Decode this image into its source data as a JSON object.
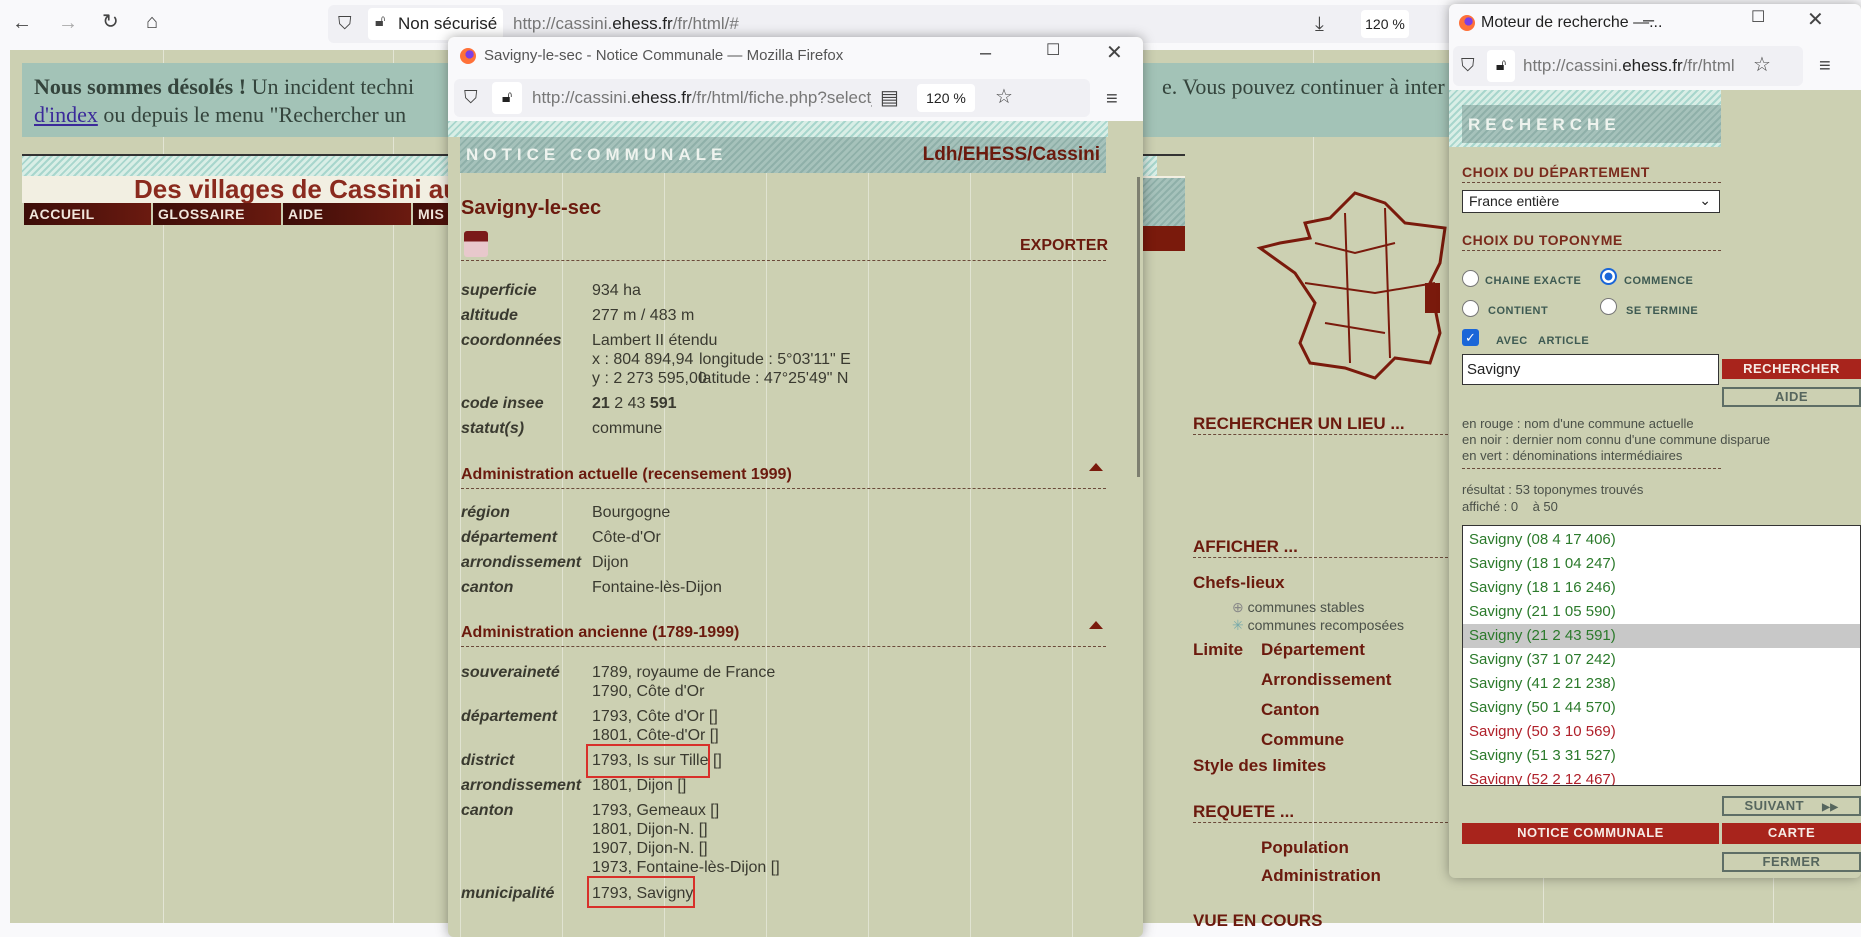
{
  "browser": {
    "security_label": "Non sécurisé",
    "url_prefix": "http://cassini.",
    "url_domain": "ehess.fr",
    "url_suffix": "/fr/html/#",
    "zoom": "120 %"
  },
  "banner": {
    "bold": "Nous sommes désolés !",
    "text1": " Un incident techni",
    "text1b": "e. Vous pouvez continuer à inter",
    "link": "d'index",
    "text2": " ou depuis le menu \"Rechercher un "
  },
  "site": {
    "title": "Des villages de Cassini aux",
    "nav": [
      "ACCUEIL",
      "GLOSSAIRE",
      "AIDE",
      "MIS"
    ]
  },
  "menu": {
    "search_place": "RECHERCHER UN LIEU ...",
    "display": "AFFICHER ...",
    "chefs_lieux": "Chefs-lieux",
    "stable": "communes stables",
    "recomposed": "communes recomposées",
    "limite": "Limite",
    "limits": [
      "Département",
      "Arrondissement",
      "Canton",
      "Commune"
    ],
    "style": "Style des limites",
    "requete": "REQUETE ...",
    "requetes": [
      "Population",
      "Administration"
    ],
    "vue": "VUE EN COURS"
  },
  "notice_window": {
    "title": "Savigny-le-sec - Notice Communale — Mozilla Firefox",
    "url_prefix": "http://cassini.",
    "url_domain": "ehess.fr",
    "url_suffix": "/fr/html/fiche.php?select_resultat",
    "zoom": "120 %",
    "header": "NOTICE COMMUNALE",
    "credit": "Ldh/EHESS/Cassini",
    "commune": "Savigny-le-sec",
    "export": "EXPORTER",
    "general": [
      {
        "label": "superficie",
        "lines": [
          "934 ha"
        ]
      },
      {
        "label": "altitude",
        "lines": [
          "277 m / 483 m"
        ]
      },
      {
        "label": "coordonnées",
        "lines": [
          "Lambert II étendu",
          "x : 804 894,94",
          "y : 2 273 595,00"
        ]
      },
      {
        "label": "code insee",
        "lines": [
          ""
        ]
      },
      {
        "label": "statut(s)",
        "lines": [
          "commune"
        ]
      }
    ],
    "longitude": "longitude : 5°03'11\" E",
    "latitude": "latitude : 47°25'49\" N",
    "insee": {
      "dep": "21",
      "mid": " 2 43 ",
      "com": "591"
    },
    "admin_current_title": "Administration actuelle (recensement 1999)",
    "admin_current": [
      {
        "label": "région",
        "value": "Bourgogne"
      },
      {
        "label": "département",
        "value": "Côte-d'Or"
      },
      {
        "label": "arrondissement",
        "value": "Dijon"
      },
      {
        "label": "canton",
        "value": "Fontaine-lès-Dijon"
      }
    ],
    "admin_old_title": "Administration ancienne (1789-1999)",
    "admin_old": [
      {
        "label": "souveraineté",
        "lines": [
          "1789, royaume de France",
          "1790, Côte d'Or"
        ]
      },
      {
        "label": "département",
        "lines": [
          "1793, Côte d'Or []",
          "1801, Côte-d'Or []"
        ]
      },
      {
        "label": "district",
        "lines": [
          "1793, Is sur Tille []"
        ]
      },
      {
        "label": "arrondissement",
        "lines": [
          "1801, Dijon []"
        ]
      },
      {
        "label": "canton",
        "lines": [
          "1793, Gemeaux []",
          "1801, Dijon-N. []",
          "1907, Dijon-N. []",
          "1973, Fontaine-lès-Dijon []"
        ]
      },
      {
        "label": "municipalité",
        "lines": [
          "1793, Savigny"
        ]
      }
    ]
  },
  "search_window": {
    "title": "Moteur de recherche —...",
    "url_prefix": "http://cassini.",
    "url_domain": "ehess.fr",
    "url_suffix": "/fr/html",
    "header": "RECHERCHE",
    "dep_title": "CHOIX DU DÉPARTEMENT",
    "dep_value": "France entière",
    "topo_title": "CHOIX DU TOPONYME",
    "options": {
      "exact": "CHAINE EXACTE",
      "starts": "COMMENCE",
      "contains": "CONTIENT",
      "ends": "SE TERMINE",
      "article": "AVEC   ARTICLE"
    },
    "selected_option": "starts",
    "article_checked": true,
    "query": "Savigny",
    "search_btn": "RECHERCHER",
    "help_btn": "AIDE",
    "legend": [
      "en rouge : nom d'une commune actuelle",
      "en noir : dernier nom connu d'une commune disparue",
      "en vert : dénominations intermédiaires"
    ],
    "result": "résultat : 53 toponymes trouvés",
    "shown": "affiché : 0    à 50",
    "results": [
      {
        "text": "Savigny (08 4 17 406)",
        "color": "green"
      },
      {
        "text": "Savigny (18 1 04 247)",
        "color": "green"
      },
      {
        "text": "Savigny (18 1 16 246)",
        "color": "green"
      },
      {
        "text": "Savigny (21 1 05 590)",
        "color": "green"
      },
      {
        "text": "Savigny (21 2 43 591)",
        "color": "green",
        "selected": true
      },
      {
        "text": "Savigny (37 1 07 242)",
        "color": "green"
      },
      {
        "text": "Savigny (41 2 21 238)",
        "color": "green"
      },
      {
        "text": "Savigny (50 1 44 570)",
        "color": "green"
      },
      {
        "text": "Savigny (50 3 10 569)",
        "color": "red"
      },
      {
        "text": "Savigny (51 3 31 527)",
        "color": "green"
      },
      {
        "text": "Savigny (52 2 12 467)",
        "color": "red"
      }
    ],
    "next_btn": "SUIVANT",
    "notice_btn": "NOTICE COMMUNALE",
    "map_btn": "CARTE",
    "close_btn": "FERMER"
  },
  "colors": {
    "page_bg": "#ccd0b2",
    "banner": "#a3c3b7",
    "brand_red": "#6b1a0e",
    "list_green": "#2b7a2b",
    "list_red": "#b0202a"
  }
}
